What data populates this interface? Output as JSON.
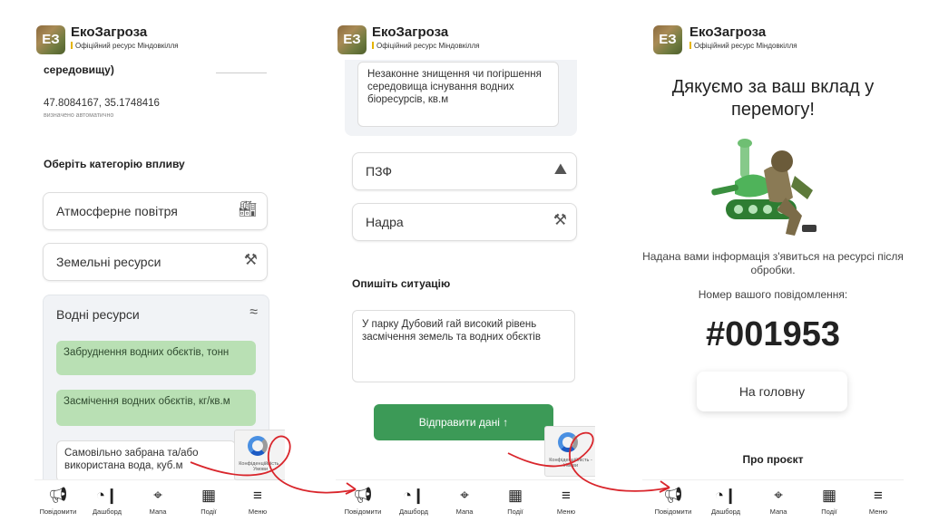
{
  "header": {
    "logo_text": "ЕЗ",
    "app_name": "ЕкоЗагроза",
    "subtitle": "Офіційний ресурс Міндовкілля"
  },
  "nav": {
    "items": [
      {
        "icon": "megaphone-icon",
        "label": "Повідомити"
      },
      {
        "icon": "dashboard-icon",
        "label": "Дашборд"
      },
      {
        "icon": "map-icon",
        "label": "Мапа"
      },
      {
        "icon": "events-icon",
        "label": "Події"
      },
      {
        "icon": "menu-icon",
        "label": "Меню"
      }
    ]
  },
  "recaptcha": {
    "text": "Конфіденційність - Умови"
  },
  "screen1": {
    "cut_text": "середовищу)",
    "coords": "47.8084167, 35.1748416",
    "coords_note": "визначено автоматично",
    "category_heading": "Оберіть категорію впливу",
    "categories": [
      "Атмосферне повітря",
      "Земельні ресурси",
      "Водні ресурси"
    ],
    "water_options": [
      "Забруднення водних обєктів, тонн",
      "Засмічення водних обєктів, кг/кв.м",
      "Самовільно забрана та/або використана вода, куб.м"
    ]
  },
  "screen2": {
    "water_option": "Незаконне знищення чи погіршення середовища існування водних біоресурсів, кв.м",
    "categories": [
      "ПЗФ",
      "Надра"
    ],
    "describe_heading": "Опишіть ситуацію",
    "description": "У парку Дубовий гай високий рівень засмічення земель та водних обєктів",
    "submit_label": "Відправити дані ↑"
  },
  "screen3": {
    "thanks_title": "Дякуємо за ваш вклад у перемогу!",
    "info_text": "Надана вами інформація з'явиться на ресурсі після обробки.",
    "number_label": "Номер вашого повідомлення:",
    "number": "#001953",
    "home_button": "На головну",
    "about": "Про проєкт"
  },
  "colors": {
    "accent": "#3c9a57",
    "light_green": "#b9e0b4",
    "arrow": "#d9262c",
    "panel": "#f1f3f6"
  }
}
